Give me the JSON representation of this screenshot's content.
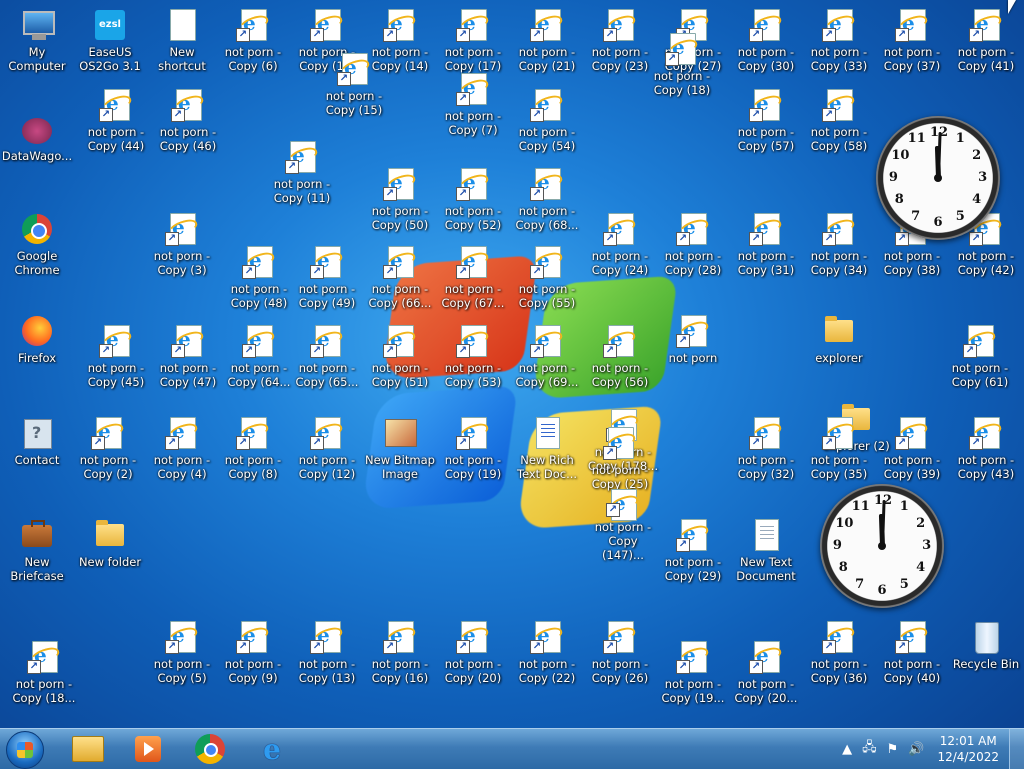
{
  "desktop_icons": [
    {
      "label": "My Computer",
      "type": "computer",
      "name": "my-computer-icon"
    },
    {
      "label": "EaseUS OS2Go 3.1",
      "type": "easeus",
      "name": "easeus-icon",
      "logo": "ezsl"
    },
    {
      "label": "New shortcut",
      "type": "doc",
      "name": "new-shortcut-icon"
    },
    {
      "label": "not porn - Copy (6)",
      "type": "html",
      "name": "html-shortcut-icon"
    },
    {
      "label": "not porn - Copy (1...",
      "type": "html",
      "name": "html-shortcut-icon"
    },
    {
      "label": "not porn - Copy (14)",
      "type": "html",
      "name": "html-shortcut-icon"
    },
    {
      "label": "not porn - Copy (17)",
      "type": "html",
      "name": "html-shortcut-icon"
    },
    {
      "label": "not porn - Copy (21)",
      "type": "html",
      "name": "html-shortcut-icon"
    },
    {
      "label": "not porn - Copy (23)",
      "type": "html",
      "name": "html-shortcut-icon"
    },
    {
      "label": "not porn - Copy (27)",
      "type": "html",
      "name": "html-shortcut-icon"
    },
    {
      "label": "not porn - Copy (30)",
      "type": "html",
      "name": "html-shortcut-icon"
    },
    {
      "label": "not porn - Copy (33)",
      "type": "html",
      "name": "html-shortcut-icon"
    },
    {
      "label": "not porn - Copy (37)",
      "type": "html",
      "name": "html-shortcut-icon"
    },
    {
      "label": "not porn - Copy (41)",
      "type": "html",
      "name": "html-shortcut-icon"
    },
    {
      "label": "not porn - Copy (18)",
      "type": "html",
      "name": "html-shortcut-icon"
    },
    {
      "label": "not porn - Copy (15)",
      "type": "html",
      "name": "html-shortcut-icon"
    },
    {
      "label": "DataWago...",
      "type": "datawago",
      "name": "datawago-icon"
    },
    {
      "label": "not porn - Copy (44)",
      "type": "html",
      "name": "html-shortcut-icon"
    },
    {
      "label": "not porn - Copy (46)",
      "type": "html",
      "name": "html-shortcut-icon"
    },
    {
      "label": "not porn - Copy (7)",
      "type": "html",
      "name": "html-shortcut-icon"
    },
    {
      "label": "not porn - Copy (54)",
      "type": "html",
      "name": "html-shortcut-icon"
    },
    {
      "label": "not porn - Copy (57)",
      "type": "html",
      "name": "html-shortcut-icon"
    },
    {
      "label": "not porn - Copy (58)",
      "type": "html",
      "name": "html-shortcut-icon"
    },
    {
      "label": "not porn - Copy (11)",
      "type": "html",
      "name": "html-shortcut-icon"
    },
    {
      "label": "not porn - Copy (50)",
      "type": "html",
      "name": "html-shortcut-icon"
    },
    {
      "label": "not porn - Copy (52)",
      "type": "html",
      "name": "html-shortcut-icon"
    },
    {
      "label": "not porn - Copy (68...",
      "type": "html",
      "name": "html-shortcut-icon"
    },
    {
      "label": "Google Chrome",
      "type": "chrome",
      "name": "google-chrome-icon"
    },
    {
      "label": "not porn - Copy (3)",
      "type": "html",
      "name": "html-shortcut-icon"
    },
    {
      "label": "not porn - Copy (24)",
      "type": "html",
      "name": "html-shortcut-icon"
    },
    {
      "label": "not porn - Copy (28)",
      "type": "html",
      "name": "html-shortcut-icon"
    },
    {
      "label": "not porn - Copy (31)",
      "type": "html",
      "name": "html-shortcut-icon"
    },
    {
      "label": "not porn - Copy (34)",
      "type": "html",
      "name": "html-shortcut-icon"
    },
    {
      "label": "not porn - Copy (38)",
      "type": "html",
      "name": "html-shortcut-icon"
    },
    {
      "label": "not porn - Copy (42)",
      "type": "html",
      "name": "html-shortcut-icon"
    },
    {
      "label": "not porn - Copy (48)",
      "type": "html",
      "name": "html-shortcut-icon"
    },
    {
      "label": "not porn - Copy (49)",
      "type": "html",
      "name": "html-shortcut-icon"
    },
    {
      "label": "not porn - Copy (66...",
      "type": "html",
      "name": "html-shortcut-icon"
    },
    {
      "label": "not porn - Copy (67...",
      "type": "html",
      "name": "html-shortcut-icon"
    },
    {
      "label": "not porn - Copy (55)",
      "type": "html",
      "name": "html-shortcut-icon"
    },
    {
      "label": "Firefox",
      "type": "firefox",
      "name": "firefox-icon"
    },
    {
      "label": "not porn - Copy (45)",
      "type": "html",
      "name": "html-shortcut-icon"
    },
    {
      "label": "not porn - Copy (47)",
      "type": "html",
      "name": "html-shortcut-icon"
    },
    {
      "label": "not porn - Copy (64...",
      "type": "html",
      "name": "html-shortcut-icon"
    },
    {
      "label": "not porn - Copy (65...",
      "type": "html",
      "name": "html-shortcut-icon"
    },
    {
      "label": "not porn - Copy (51)",
      "type": "html",
      "name": "html-shortcut-icon"
    },
    {
      "label": "not porn - Copy (53)",
      "type": "html",
      "name": "html-shortcut-icon"
    },
    {
      "label": "not porn - Copy (69...",
      "type": "html",
      "name": "html-shortcut-icon"
    },
    {
      "label": "not porn - Copy (56)",
      "type": "html",
      "name": "html-shortcut-icon"
    },
    {
      "label": "not porn",
      "type": "html",
      "name": "html-shortcut-icon"
    },
    {
      "label": "explorer",
      "type": "folder",
      "name": "explorer-icon"
    },
    {
      "label": "not porn - Copy (61)",
      "type": "html",
      "name": "html-shortcut-icon"
    },
    {
      "label": "Contact",
      "type": "contact",
      "name": "contact-icon"
    },
    {
      "label": "not porn - Copy (2)",
      "type": "html",
      "name": "html-shortcut-icon"
    },
    {
      "label": "not porn - Copy (4)",
      "type": "html",
      "name": "html-shortcut-icon"
    },
    {
      "label": "not porn - Copy (8)",
      "type": "html",
      "name": "html-shortcut-icon"
    },
    {
      "label": "not porn - Copy (12)",
      "type": "html",
      "name": "html-shortcut-icon"
    },
    {
      "label": "New Bitmap Image",
      "type": "bmp",
      "name": "bitmap-image-icon"
    },
    {
      "label": "not porn - Copy (19)",
      "type": "html",
      "name": "html-shortcut-icon"
    },
    {
      "label": "New Rich Text Doc...",
      "type": "rtf",
      "name": "rich-text-doc-icon"
    },
    {
      "label": "not porn - Copy (178...",
      "type": "html",
      "name": "html-shortcut-icon"
    },
    {
      "label": "not porn - Copy (25)",
      "type": "html",
      "name": "html-shortcut-icon"
    },
    {
      "label": "not porn - Copy (32)",
      "type": "html",
      "name": "html-shortcut-icon"
    },
    {
      "label": "explorer (2)",
      "type": "folder",
      "name": "explorer-icon"
    },
    {
      "label": "not porn - Copy (35)",
      "type": "html",
      "name": "html-shortcut-icon"
    },
    {
      "label": "not porn - Copy (39)",
      "type": "html",
      "name": "html-shortcut-icon"
    },
    {
      "label": "not porn - Copy (43)",
      "type": "html",
      "name": "html-shortcut-icon"
    },
    {
      "label": "New Briefcase",
      "type": "briefcase",
      "name": "briefcase-icon"
    },
    {
      "label": "New folder",
      "type": "folder",
      "name": "folder-icon"
    },
    {
      "label": "not porn - Copy (147)...",
      "type": "html",
      "name": "html-shortcut-icon"
    },
    {
      "label": "not porn - Copy (29)",
      "type": "html",
      "name": "html-shortcut-icon"
    },
    {
      "label": "New Text Document",
      "type": "txt",
      "name": "text-document-icon"
    },
    {
      "label": "not porn - Copy (5)",
      "type": "html",
      "name": "html-shortcut-icon"
    },
    {
      "label": "not porn - Copy (9)",
      "type": "html",
      "name": "html-shortcut-icon"
    },
    {
      "label": "not porn - Copy (13)",
      "type": "html",
      "name": "html-shortcut-icon"
    },
    {
      "label": "not porn - Copy (16)",
      "type": "html",
      "name": "html-shortcut-icon"
    },
    {
      "label": "not porn - Copy (20)",
      "type": "html",
      "name": "html-shortcut-icon"
    },
    {
      "label": "not porn - Copy (22)",
      "type": "html",
      "name": "html-shortcut-icon"
    },
    {
      "label": "not porn - Copy (26)",
      "type": "html",
      "name": "html-shortcut-icon"
    },
    {
      "label": "not porn - Copy (36)",
      "type": "html",
      "name": "html-shortcut-icon"
    },
    {
      "label": "not porn - Copy (40)",
      "type": "html",
      "name": "html-shortcut-icon"
    },
    {
      "label": "Recycle Bin",
      "type": "recycle",
      "name": "recycle-bin-icon"
    },
    {
      "label": "not porn - Copy (18...",
      "type": "html",
      "name": "html-shortcut-icon"
    },
    {
      "label": "not porn - Copy (19...",
      "type": "html",
      "name": "html-shortcut-icon"
    },
    {
      "label": "not porn - Copy (20...",
      "type": "html",
      "name": "html-shortcut-icon"
    }
  ],
  "clocks": [
    {
      "name": "clock-gadget-top",
      "numbers": [
        "12",
        "1",
        "2",
        "3",
        "4",
        "5",
        "6",
        "7",
        "8",
        "9",
        "10",
        "11"
      ]
    },
    {
      "name": "clock-gadget-bottom",
      "numbers": [
        "12",
        "1",
        "2",
        "3",
        "4",
        "5",
        "6",
        "7",
        "8",
        "9",
        "10",
        "11"
      ]
    }
  ],
  "taskbar": {
    "start_icon": "windows-orb-icon",
    "pinned": [
      {
        "name": "explorer-taskbar-button",
        "icon": "folder-icon"
      },
      {
        "name": "media-player-taskbar-button",
        "icon": "media-player-icon"
      },
      {
        "name": "chrome-taskbar-button",
        "icon": "chrome-icon"
      },
      {
        "name": "ie-taskbar-button",
        "icon": "internet-explorer-icon",
        "glyph": "e"
      }
    ],
    "tray": {
      "show_hidden": "▲",
      "network": "🖧",
      "flag": "⚑",
      "volume": "🔊",
      "time": "12:01 AM",
      "date": "12/4/2022"
    }
  }
}
